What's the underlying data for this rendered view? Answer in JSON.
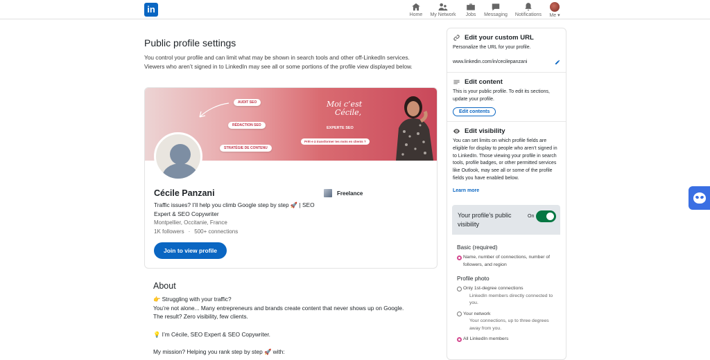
{
  "nav": {
    "logo": "in",
    "items": [
      {
        "label": "Home",
        "icon": "home-icon"
      },
      {
        "label": "My Network",
        "icon": "network-icon"
      },
      {
        "label": "Jobs",
        "icon": "briefcase-icon"
      },
      {
        "label": "Messaging",
        "icon": "chat-icon"
      },
      {
        "label": "Notifications",
        "icon": "bell-icon"
      },
      {
        "label": "Me ▾",
        "icon": "avatar"
      }
    ]
  },
  "main": {
    "title": "Public profile settings",
    "description": "You control your profile and can limit what may be shown in search tools and other off-LinkedIn services. Viewers who aren’t signed in to LinkedIn may see all or some portions of the profile view displayed below."
  },
  "banner": {
    "pill1": "AUDIT SEO",
    "pill2": "RÉDACTION SEO",
    "pill3": "STRATÉGIE DE CONTENU",
    "moi": "Moi c’est",
    "cecile": "Cécile,",
    "expert": "EXPERTE SEO",
    "pret": "Prêt·e à transformer tes mots en clients ?"
  },
  "profile": {
    "name": "Cécile Panzani",
    "headline": "Traffic issues? I’ll help you climb Google step by step 🚀 | SEO Expert & SEO Copywriter",
    "location": "Montpellier, Occitanie, France",
    "followers": "1K followers",
    "separator": "·",
    "connections": "500+ connections",
    "company": "Freelance",
    "join_label": "Join to view profile"
  },
  "about": {
    "title": "About",
    "line1": "👉 Struggling with your traffic?",
    "line2": "You’re not alone... Many entrepreneurs and brands create content that never shows up on Google.",
    "line3": "The result? Zero visibility, few clients.",
    "line4": "💡 I’m Cécile, SEO Expert & SEO Copywriter.",
    "line5": "My mission? Helping you rank step by step 🚀 with:"
  },
  "sidebar": {
    "url_title": "Edit your custom URL",
    "url_desc": "Personalize the URL for your profile.",
    "url_value": "www.linkedin.com/in/cecilepanzani",
    "content_title": "Edit content",
    "content_desc": "This is your public profile. To edit its sections, update your profile.",
    "content_btn": "Edit contents",
    "vis_title": "Edit visibility",
    "vis_desc": "You can set limits on which profile fields are eligible for display to people who aren’t signed in to LinkedIn. Those viewing your profile in search tools, profile badges, or other permitted services like Outlook, may see all or some of the profile fields you have enabled below.",
    "learn_more": "Learn more"
  },
  "visibility": {
    "title": "Your profile’s public visibility",
    "state": "On",
    "basic_title": "Basic (required)",
    "basic_opt": "Name, number of connections, number of followers, and region",
    "photo_title": "Profile photo",
    "opt1": "Only 1st-degree connections",
    "opt1_sub": "LinkedIn members directly connected to you.",
    "opt2": "Your network",
    "opt2_sub": "Your connections, up to three degrees away from you.",
    "opt3": "All LinkedIn members"
  },
  "colors": {
    "brand": "#0a66c2",
    "toggle_on": "#057642",
    "radio_selected": "#d4488f"
  }
}
